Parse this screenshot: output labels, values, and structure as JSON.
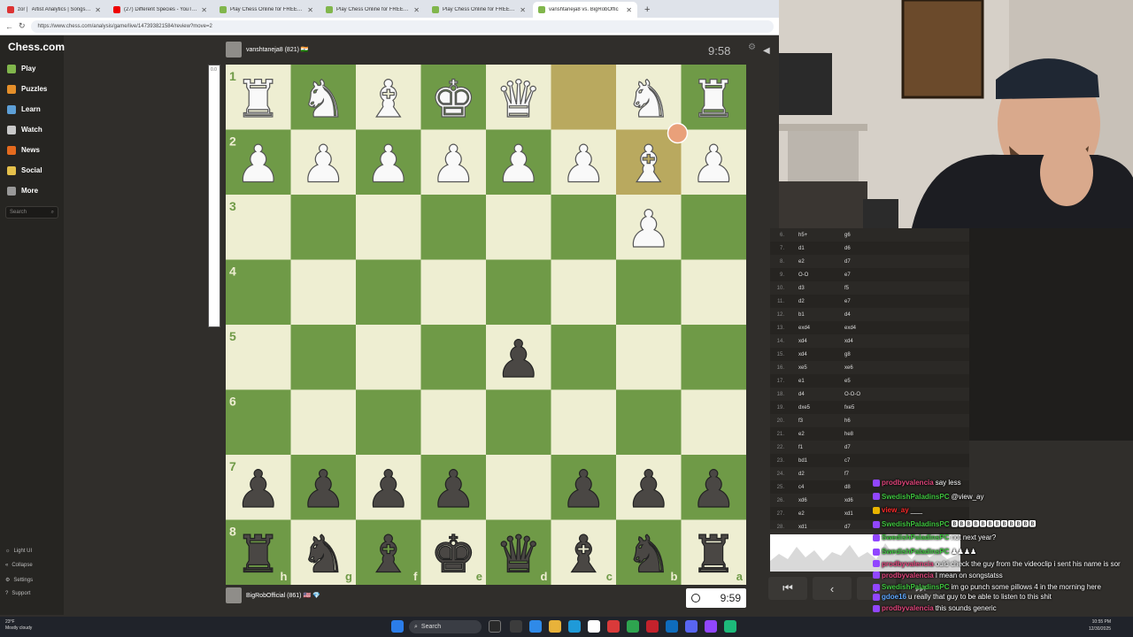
{
  "browser": {
    "tabs": [
      {
        "title": "Artist Analytics | Songstats",
        "prefix": "zor |",
        "favicon_color": "#d33"
      },
      {
        "title": "(27) Different Species - YouTube",
        "favicon_color": "#e00"
      },
      {
        "title": "Play Chess Online for FREE - 2 Pla",
        "favicon_color": "#81b64c"
      },
      {
        "title": "Play Chess Online for FREE - 2 Pla",
        "favicon_color": "#81b64c"
      },
      {
        "title": "Play Chess Online for FREE - 2 Pla",
        "favicon_color": "#81b64c"
      },
      {
        "title": "vanshtaneja8 vs. BigRobOffic",
        "favicon_color": "#81b64c"
      }
    ],
    "url": "https://www.chess.com/analysis/game/live/147393821584/review?move=2"
  },
  "sidebar": {
    "logo": "Chess.com",
    "items": [
      {
        "label": "Play",
        "color": "#81b64c"
      },
      {
        "label": "Puzzles",
        "color": "#e58f2a"
      },
      {
        "label": "Learn",
        "color": "#5d9fd6"
      },
      {
        "label": "Watch",
        "color": "#c9c9c9"
      },
      {
        "label": "News",
        "color": "#e46a1e"
      },
      {
        "label": "Social",
        "color": "#e5c04b"
      },
      {
        "label": "More",
        "color": "#999999"
      }
    ],
    "search_placeholder": "Search",
    "footer": [
      "Light UI",
      "Collapse",
      "Settings",
      "Support"
    ]
  },
  "game": {
    "top_player": "vanshtaneja8 (821) 🇮🇳",
    "top_time": "9:58",
    "bottom_player": "BigRobOfficial (861) 🇺🇸 💎",
    "bottom_time": "9:59",
    "eval_label": "0.0",
    "ranks": [
      "1",
      "2",
      "3",
      "4",
      "5",
      "6",
      "7",
      "8"
    ],
    "files": [
      "h",
      "g",
      "f",
      "e",
      "d",
      "c",
      "b",
      "a"
    ]
  },
  "board": {
    "light": "#eeeed2",
    "dark": "#6f9a47",
    "highlight": "#b9a95f",
    "rows": [
      [
        "wR",
        "wN",
        "wB",
        "wK",
        "wQ",
        "",
        "wN",
        "wR"
      ],
      [
        "wP",
        "wP",
        "wP",
        "wP",
        "wP",
        "wP",
        "wB",
        "wP"
      ],
      [
        "",
        "",
        "",
        "",
        "",
        "",
        "wP",
        ""
      ],
      [
        "",
        "",
        "",
        "",
        "",
        "",
        "",
        ""
      ],
      [
        "",
        "",
        "",
        "",
        "bP",
        "",
        "",
        ""
      ],
      [
        "",
        "",
        "",
        "",
        "",
        "",
        "",
        ""
      ],
      [
        "bP",
        "bP",
        "bP",
        "bP",
        "",
        "bP",
        "bP",
        "bP"
      ],
      [
        "bR",
        "bN",
        "bB",
        "bK",
        "bQ",
        "bB",
        "bN",
        "bR"
      ]
    ],
    "highlights": [
      [
        0,
        5
      ],
      [
        1,
        6
      ]
    ]
  },
  "moves": [
    {
      "n": "6.",
      "w": "h5+",
      "b": "g6"
    },
    {
      "n": "7.",
      "w": "d1",
      "b": "d6"
    },
    {
      "n": "8.",
      "w": "e2",
      "b": "d7"
    },
    {
      "n": "9.",
      "w": "O-O",
      "b": "e7"
    },
    {
      "n": "10.",
      "w": "d3",
      "b": "f5"
    },
    {
      "n": "11.",
      "w": "d2",
      "b": "e7"
    },
    {
      "n": "12.",
      "w": "b1",
      "b": "d4"
    },
    {
      "n": "13.",
      "w": "exd4",
      "b": "exd4"
    },
    {
      "n": "14.",
      "w": "xd4",
      "b": "xd4"
    },
    {
      "n": "15.",
      "w": "xd4",
      "b": "g8"
    },
    {
      "n": "16.",
      "w": "xe5",
      "b": "xe6"
    },
    {
      "n": "17.",
      "w": "e1",
      "b": "e5"
    },
    {
      "n": "18.",
      "w": "d4",
      "b": "O-O-O"
    },
    {
      "n": "19.",
      "w": "dxe5",
      "b": "fxe5"
    },
    {
      "n": "20.",
      "w": "f3",
      "b": "h6"
    },
    {
      "n": "21.",
      "w": "e2",
      "b": "he8"
    },
    {
      "n": "22.",
      "w": "f1",
      "b": "d7"
    },
    {
      "n": "23.",
      "w": "bd1",
      "b": "c7"
    },
    {
      "n": "24.",
      "w": "d2",
      "b": "f7"
    },
    {
      "n": "25.",
      "w": "c4",
      "b": "d8"
    },
    {
      "n": "26.",
      "w": "xd6",
      "b": "xd6"
    },
    {
      "n": "27.",
      "w": "e2",
      "b": "xd1"
    },
    {
      "n": "28.",
      "w": "xd1",
      "b": "d7"
    }
  ],
  "controls": [
    "⏮",
    "‹",
    "›",
    "⏭"
  ],
  "chat": [
    {
      "user": "prodbyvalencia",
      "ucolor": "#e0457b",
      "msg": "say less",
      "badge": "#9146ff"
    },
    {
      "user": "SwedishPaladinsPC",
      "ucolor": "#3fc43f",
      "msg": "@view_ay",
      "badge": "#9146ff"
    },
    {
      "user": "view_ay",
      "ucolor": "#ff2a2a",
      "msg": "___",
      "badge": "#e9b400"
    },
    {
      "user": "SwedishPaladinsPC",
      "ucolor": "#3fc43f",
      "msg": "🅱🅱🅱🅱🅱🅱🅱🅱🅱🅱🅱🅱",
      "badge": "#9146ff"
    },
    {
      "user": "SwedishPaladinsPC",
      "ucolor": "#3fc43f",
      "msg": "not next year?",
      "badge": "#9146ff"
    },
    {
      "user": "SwedishPaladinsPC",
      "ucolor": "#3fc43f",
      "msg": "♟♟♟♟",
      "badge": "#9146ff"
    },
    {
      "user": "prodbyvalencia",
      "ucolor": "#e0457b",
      "msg": "ould check the guy from the videoclip i sent his name is sor",
      "badge": "#9146ff"
    },
    {
      "user": "prodbyvalencia",
      "ucolor": "#e0457b",
      "msg": "I mean on songstatss",
      "badge": "#9146ff"
    },
    {
      "user": "SwedishPaladinsPC",
      "ucolor": "#3fc43f",
      "msg": "im go punch some pillows 4 in the morning here",
      "badge": "#9146ff"
    },
    {
      "user": "gdoe16",
      "ucolor": "#5fa8ff",
      "msg": "u really that guy to be able to listen to this shit",
      "badge": "#9146ff"
    },
    {
      "user": "prodbyvalencia",
      "ucolor": "#e0457b",
      "msg": "this sounds generic",
      "badge": "#9146ff"
    }
  ],
  "taskbar": {
    "weather_temp": "23°F",
    "weather_desc": "Mostly cloudy",
    "search": "Search",
    "time": "10:55 PM",
    "date": "12/30/2025"
  }
}
